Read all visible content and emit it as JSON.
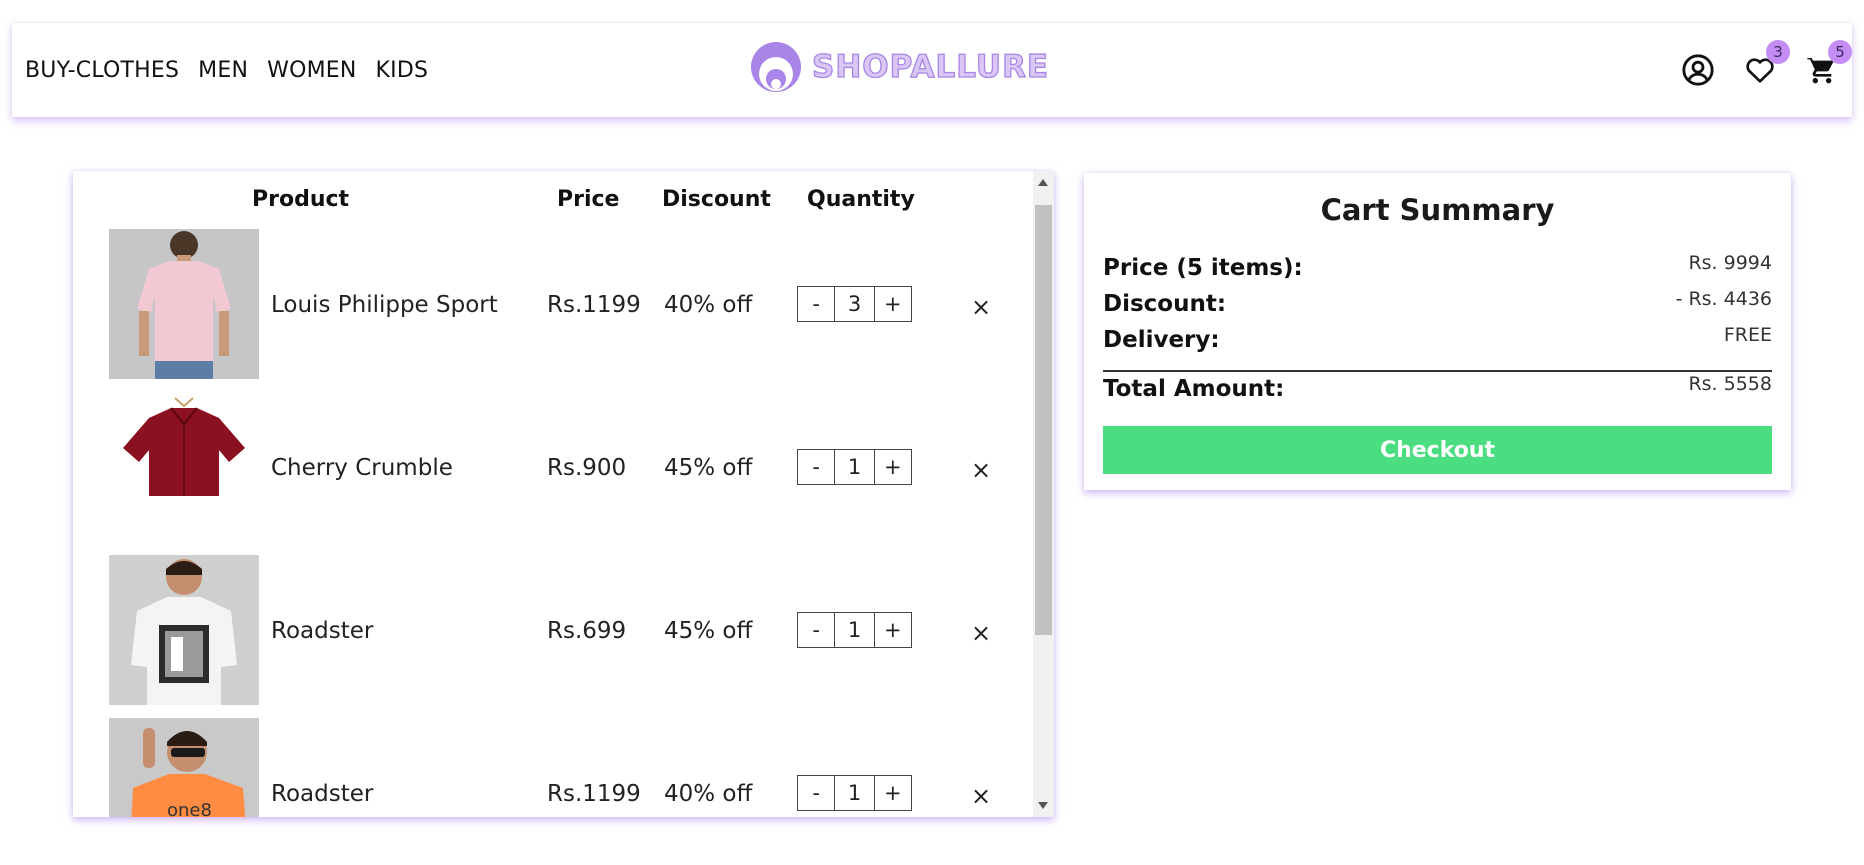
{
  "header": {
    "nav": [
      "BUY-CLOTHES",
      "MEN",
      "WOMEN",
      "KIDS"
    ],
    "brand": "SHOPALLURE",
    "wishlist_count": "3",
    "cart_count": "5",
    "icons": [
      "account-icon",
      "heart-icon",
      "cart-icon"
    ],
    "accent": "#c48cf5"
  },
  "cart": {
    "columns": [
      "Product",
      "Price",
      "Discount",
      "Quantity"
    ],
    "items": [
      {
        "name": "Louis Philippe Sport",
        "price": "Rs.1199",
        "discount": "40% off",
        "qty": "3",
        "image": "pink polo shirt",
        "remove": "×",
        "minus": "-",
        "plus": "+"
      },
      {
        "name": "Cherry Crumble",
        "price": "Rs.900",
        "discount": "45% off",
        "qty": "1",
        "image": "maroon shirt",
        "remove": "×",
        "minus": "-",
        "plus": "+"
      },
      {
        "name": "Roadster",
        "price": "Rs.699",
        "discount": "45% off",
        "qty": "1",
        "image": "white graphic t-shirt",
        "remove": "×",
        "minus": "-",
        "plus": "+"
      },
      {
        "name": "Roadster",
        "price": "Rs.1199",
        "discount": "40% off",
        "qty": "1",
        "image": "orange t-shirt",
        "remove": "×",
        "minus": "-",
        "plus": "+"
      }
    ]
  },
  "summary": {
    "title": "Cart Summary",
    "price_label": "Price (5 items):",
    "price_value": "Rs. 9994",
    "discount_label": "Discount:",
    "discount_value": "- Rs. 4436",
    "delivery_label": "Delivery:",
    "delivery_value": "FREE",
    "total_label": "Total Amount:",
    "total_value": "Rs. 5558",
    "checkout_label": "Checkout",
    "checkout_color": "#4ade80"
  }
}
